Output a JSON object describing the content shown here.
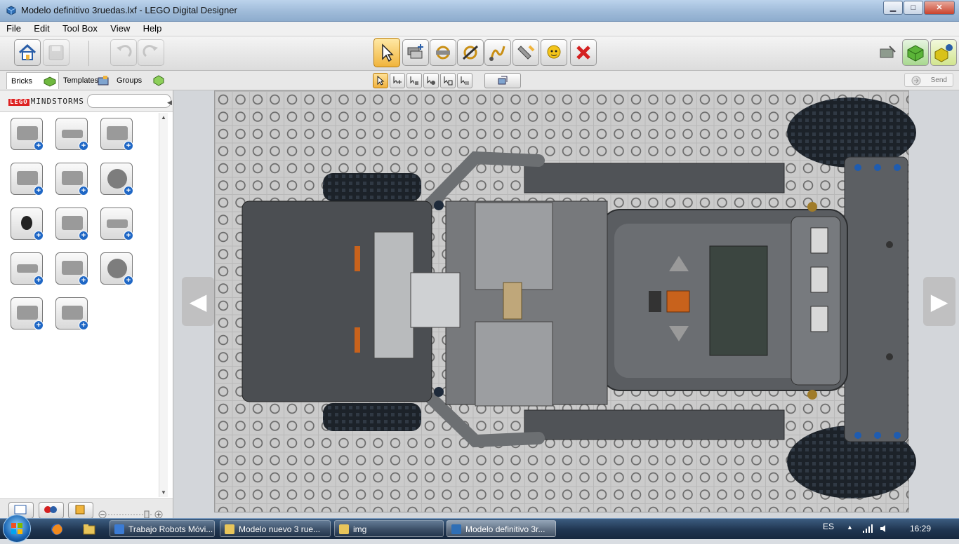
{
  "window": {
    "title": "Modelo definitivo 3ruedas.lxf - LEGO Digital Designer",
    "minimize": "▁",
    "maximize": "□",
    "close": "✕"
  },
  "menu": [
    "File",
    "Edit",
    "Tool Box",
    "View",
    "Help"
  ],
  "toolbar": {
    "left_icons": [
      "home-icon",
      "save-icon",
      "undo-icon",
      "redo-icon"
    ],
    "tools": [
      "select-tool-icon",
      "clone-tool-icon",
      "hinge-tool-icon",
      "hinge-align-tool-icon",
      "flex-tool-icon",
      "paint-tool-icon",
      "hide-tool-icon",
      "delete-tool-icon"
    ],
    "right_icons": [
      "build-mode-icon",
      "view-mode-icon",
      "building-guide-mode-icon"
    ]
  },
  "tabs": [
    "Bricks",
    "Templates",
    "Groups"
  ],
  "send_label": "Send",
  "palette": {
    "brand": "MINDSTORMS",
    "brand_prefix": "LEGO",
    "search_placeholder": "",
    "bricks": [
      "brick-2x2-round",
      "technic-beam-1x4",
      "plate-2x2",
      "plate-wedge",
      "technic-brick-holes",
      "gear-24-tooth",
      "ball-sensor",
      "nxt-motor",
      "technic-liftarm-3",
      "technic-liftarm-4",
      "axle-pin",
      "gear-crown",
      "pipe-round",
      "tow-ball"
    ]
  },
  "taskbar": {
    "tasks": [
      "Trabajo Robots Móvi...",
      "Modelo nuevo 3 rue...",
      "img",
      "Modelo definitivo 3r..."
    ],
    "language": "ES",
    "clock": "16:29"
  },
  "colors": {
    "selected_tool": "#f0b43c",
    "delete_red": "#d42020",
    "baseplate": "#cbcbcb"
  }
}
